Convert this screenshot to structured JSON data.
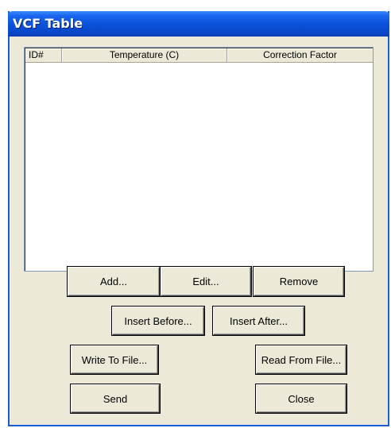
{
  "window": {
    "title": "VCF Table"
  },
  "table": {
    "columns": [
      "ID#",
      "Temperature (C)",
      "Correction Factor"
    ],
    "rows": []
  },
  "buttons": {
    "add": "Add...",
    "edit": "Edit...",
    "remove": "Remove",
    "insert_before": "Insert Before...",
    "insert_after": "Insert After...",
    "write_to_file": "Write To File...",
    "read_from_file": "Read From File...",
    "send": "Send",
    "close": "Close"
  },
  "colors": {
    "titlebar": "#0b50d9",
    "dialog_face": "#ece9d8"
  }
}
